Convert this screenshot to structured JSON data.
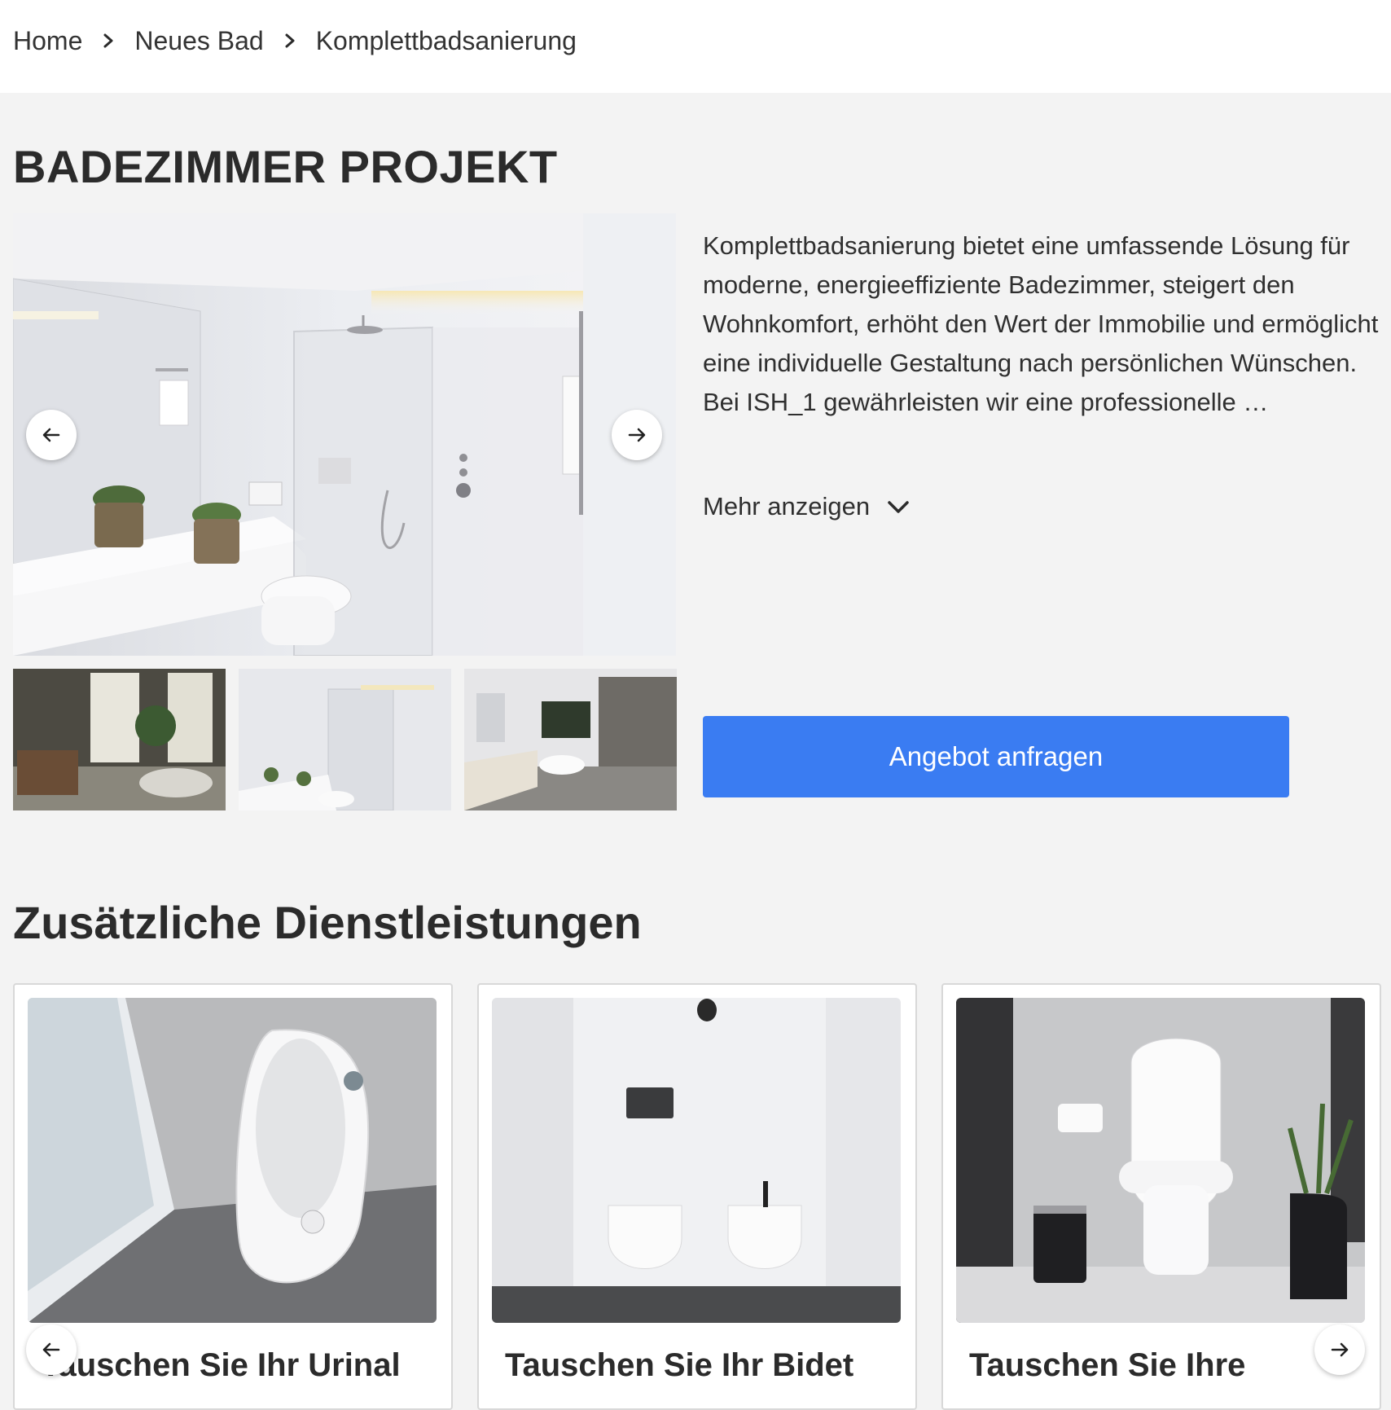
{
  "breadcrumb": {
    "items": [
      "Home",
      "Neues Bad",
      "Komplettbadsanierung"
    ]
  },
  "page_title": "BADEZIMMER PROJEKT",
  "gallery": {
    "prev_icon": "arrow-left-icon",
    "next_icon": "arrow-right-icon",
    "thumbnails": [
      "thumbnail-classic-bathroom",
      "thumbnail-white-shower-bathroom",
      "thumbnail-modern-bathtub-bathroom"
    ]
  },
  "description": {
    "paragraph1": "Komplettbadsanierung bietet eine umfassende Lösung für moderne, energieeffiziente Badezimmer, steigert den Wohnkomfort, erhöht den Wert der Immobilie und ermöglicht eine individuelle Gestaltung nach persönlichen Wünschen.",
    "paragraph2": "Bei ISH_1 gewährleisten wir eine professionelle …",
    "more_label": "Mehr anzeigen"
  },
  "cta_label": "Angebot anfragen",
  "services": {
    "title": "Zusätzliche Dienstleistungen",
    "cards": [
      {
        "title": "Tauschen Sie Ihr Urinal"
      },
      {
        "title": "Tauschen Sie Ihr Bidet"
      },
      {
        "title": "Tauschen Sie Ihre"
      }
    ]
  },
  "colors": {
    "accent": "#3a7cf2",
    "page_bg": "#f3f3f3",
    "text": "#2b2b2b"
  }
}
